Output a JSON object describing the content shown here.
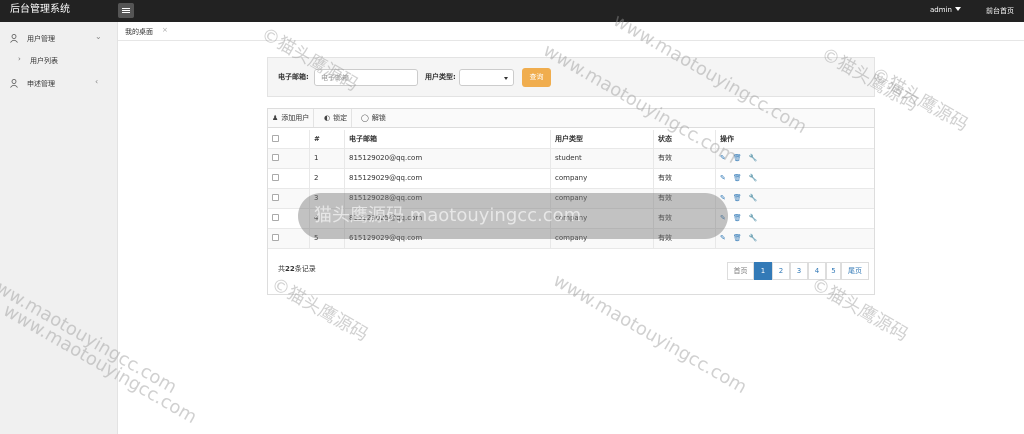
{
  "topbar": {
    "brand": "后台管理系统",
    "user": "admin",
    "home_link": "前台首页"
  },
  "sidebar": {
    "items": [
      {
        "label": "用户管理",
        "icon": "user-icon",
        "expanded": true
      },
      {
        "label": "申述管理",
        "icon": "user-icon",
        "expanded": false
      }
    ],
    "sub_items": [
      {
        "label": "用户列表"
      }
    ]
  },
  "tabs": [
    {
      "label": "我的桌面",
      "close": "×"
    }
  ],
  "search": {
    "email_label": "电子邮箱:",
    "email_placeholder": "电子邮箱",
    "type_label": "用户类型:",
    "type_value": "",
    "query_button": "查询"
  },
  "toolbar": {
    "add": "添加用户",
    "lock": "锁定",
    "unlock": "解锁"
  },
  "table": {
    "columns": [
      "#",
      "电子邮箱",
      "用户类型",
      "状态",
      "操作"
    ],
    "rows": [
      {
        "id": "1",
        "email": "815129020@qq.com",
        "type": "student",
        "status": "有效"
      },
      {
        "id": "2",
        "email": "815129029@qq.com",
        "type": "company",
        "status": "有效"
      },
      {
        "id": "3",
        "email": "815129028@qq.com",
        "type": "company",
        "status": "有效"
      },
      {
        "id": "4",
        "email": "815129025@qq.com",
        "type": "company",
        "status": "有效"
      },
      {
        "id": "5",
        "email": "615129029@qq.com",
        "type": "company",
        "status": "有效"
      }
    ],
    "actions": [
      "edit-icon",
      "trash-icon",
      "wrench-icon"
    ]
  },
  "footer": {
    "total_prefix": "共",
    "total_count": "22",
    "total_suffix": "条记录"
  },
  "pagination": {
    "first": "首页",
    "pages": [
      "1",
      "2",
      "3",
      "4",
      "5"
    ],
    "last": "尾页",
    "current": 1
  },
  "watermark": {
    "text": "www.maotouyingcc.com",
    "brand": "©猫头鹰源码",
    "banner": "猫头鹰源码 maotouyingcc.com"
  },
  "colors": {
    "topbar": "#222222",
    "accent": "#337ab7",
    "query_button": "#f0ad4e"
  }
}
